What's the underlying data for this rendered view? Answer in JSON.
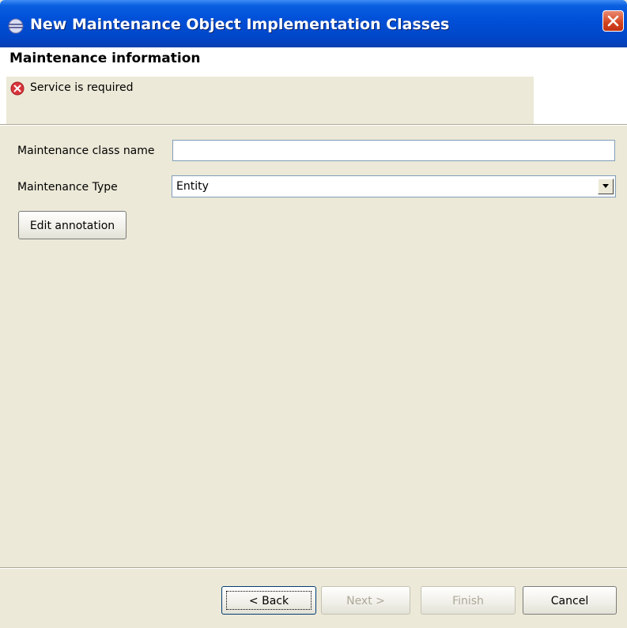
{
  "window": {
    "title": "New Maintenance Object Implementation Classes"
  },
  "header": {
    "title": "Maintenance information",
    "message": "Service is required",
    "message_icon": "error-icon"
  },
  "form": {
    "class_name_label": "Maintenance class name",
    "class_name_value": "",
    "type_label": "Maintenance Type",
    "type_value": "Entity",
    "edit_annotation_label": "Edit annotation"
  },
  "footer": {
    "back_label": "< Back",
    "next_label": "Next >",
    "finish_label": "Finish",
    "cancel_label": "Cancel"
  },
  "colors": {
    "titlebar": "#0050d8",
    "dialog_bg": "#ece9d8",
    "error": "#d9343a"
  }
}
